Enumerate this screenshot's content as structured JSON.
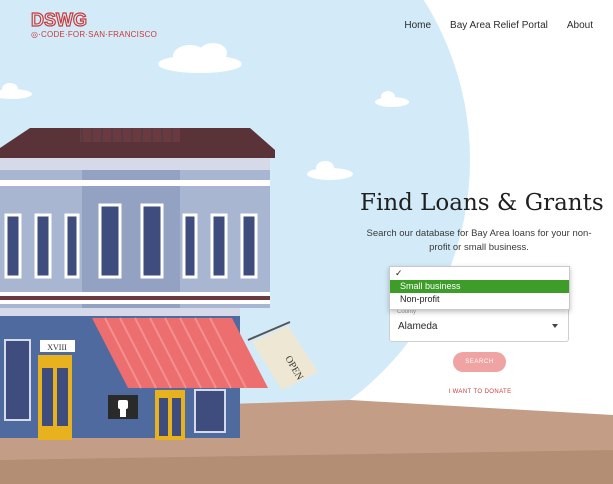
{
  "brand": {
    "logo_text": "DSWG",
    "tagline": "CODE·FOR·SAN·FRANCISCO",
    "accent_color": "#c93a3a"
  },
  "nav": {
    "items": [
      {
        "label": "Home"
      },
      {
        "label": "Bay Area Relief Portal"
      },
      {
        "label": "About"
      }
    ]
  },
  "hero": {
    "title": "Find Loans & Grants",
    "subtitle": "Search our database for Bay Area loans for your non-profit or small business."
  },
  "form": {
    "type_dropdown": {
      "check_glyph": "✓",
      "options": [
        "Small business",
        "Non-profit"
      ],
      "highlighted": "Small business",
      "highlight_color": "#3d9d28"
    },
    "county": {
      "label": "County",
      "value": "Alameda"
    },
    "search_label": "SEARCH",
    "donate_label": "I WANT TO DONATE"
  },
  "illustration": {
    "cornice_sign": "XVIII",
    "flag_text": "OPEN",
    "fist_icon": "raised-fist-icon"
  }
}
